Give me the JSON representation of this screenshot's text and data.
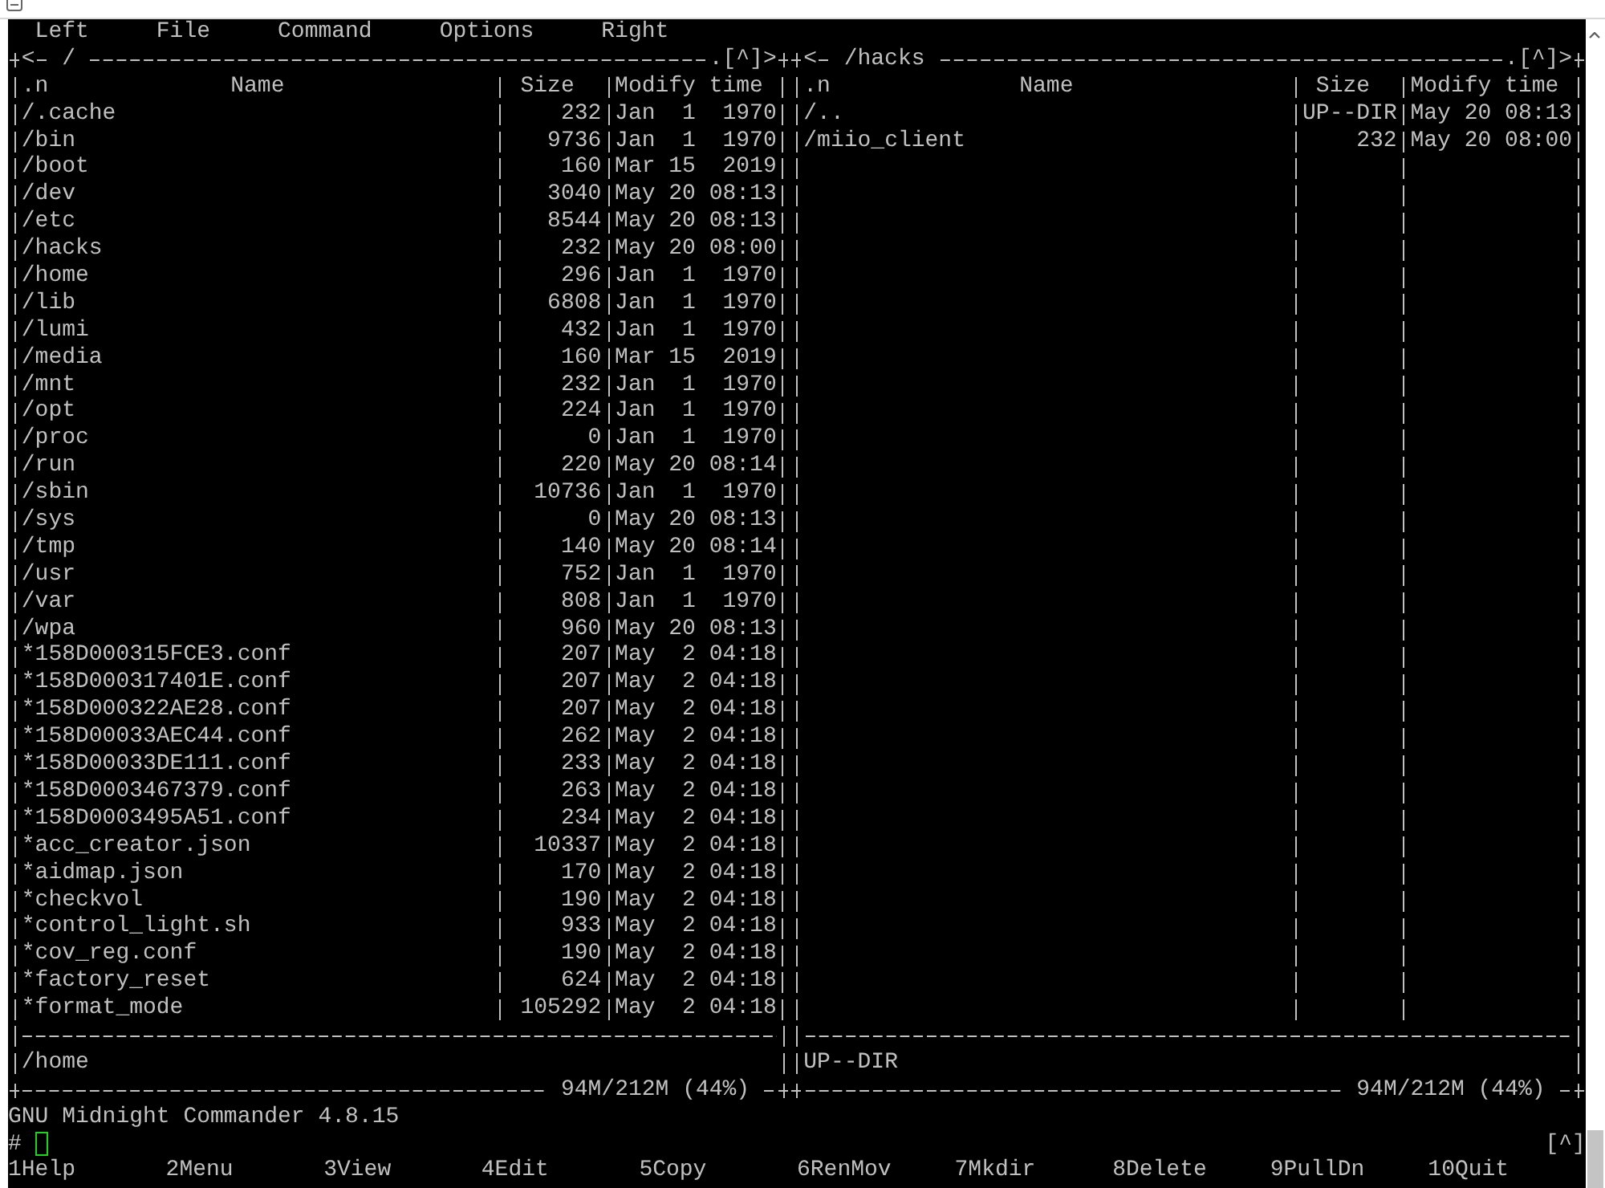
{
  "menu_bar": [
    "Left",
    "File",
    "Command",
    "Options",
    "Right"
  ],
  "panels": [
    {
      "back_button": "<",
      "path": "/",
      "hidden_toggle": ".",
      "history_button": "[^]",
      "forward_button": ">",
      "columns": {
        "sort": ".n",
        "name": "Name",
        "size": "Size",
        "modify_time": "Modify time"
      },
      "rows": [
        {
          "name": "/.cache",
          "size": "232",
          "modify_time": "Jan  1  1970"
        },
        {
          "name": "/bin",
          "size": "9736",
          "modify_time": "Jan  1  1970"
        },
        {
          "name": "/boot",
          "size": "160",
          "modify_time": "Mar 15  2019"
        },
        {
          "name": "/dev",
          "size": "3040",
          "modify_time": "May 20 08:13"
        },
        {
          "name": "/etc",
          "size": "8544",
          "modify_time": "May 20 08:13"
        },
        {
          "name": "/hacks",
          "size": "232",
          "modify_time": "May 20 08:00"
        },
        {
          "name": "/home",
          "size": "296",
          "modify_time": "Jan  1  1970"
        },
        {
          "name": "/lib",
          "size": "6808",
          "modify_time": "Jan  1  1970"
        },
        {
          "name": "/lumi",
          "size": "432",
          "modify_time": "Jan  1  1970"
        },
        {
          "name": "/media",
          "size": "160",
          "modify_time": "Mar 15  2019"
        },
        {
          "name": "/mnt",
          "size": "232",
          "modify_time": "Jan  1  1970"
        },
        {
          "name": "/opt",
          "size": "224",
          "modify_time": "Jan  1  1970"
        },
        {
          "name": "/proc",
          "size": "0",
          "modify_time": "Jan  1  1970"
        },
        {
          "name": "/run",
          "size": "220",
          "modify_time": "May 20 08:14"
        },
        {
          "name": "/sbin",
          "size": "10736",
          "modify_time": "Jan  1  1970"
        },
        {
          "name": "/sys",
          "size": "0",
          "modify_time": "May 20 08:13"
        },
        {
          "name": "/tmp",
          "size": "140",
          "modify_time": "May 20 08:14"
        },
        {
          "name": "/usr",
          "size": "752",
          "modify_time": "Jan  1  1970"
        },
        {
          "name": "/var",
          "size": "808",
          "modify_time": "Jan  1  1970"
        },
        {
          "name": "/wpa",
          "size": "960",
          "modify_time": "May 20 08:13"
        },
        {
          "name": "*158D000315FCE3.conf",
          "size": "207",
          "modify_time": "May  2 04:18"
        },
        {
          "name": "*158D000317401E.conf",
          "size": "207",
          "modify_time": "May  2 04:18"
        },
        {
          "name": "*158D000322AE28.conf",
          "size": "207",
          "modify_time": "May  2 04:18"
        },
        {
          "name": "*158D00033AEC44.conf",
          "size": "262",
          "modify_time": "May  2 04:18"
        },
        {
          "name": "*158D00033DE111.conf",
          "size": "233",
          "modify_time": "May  2 04:18"
        },
        {
          "name": "*158D0003467379.conf",
          "size": "263",
          "modify_time": "May  2 04:18"
        },
        {
          "name": "*158D0003495A51.conf",
          "size": "234",
          "modify_time": "May  2 04:18"
        },
        {
          "name": "*acc_creator.json",
          "size": "10337",
          "modify_time": "May  2 04:18"
        },
        {
          "name": "*aidmap.json",
          "size": "170",
          "modify_time": "May  2 04:18"
        },
        {
          "name": "*checkvol",
          "size": "190",
          "modify_time": "May  2 04:18"
        },
        {
          "name": "*control_light.sh",
          "size": "933",
          "modify_time": "May  2 04:18"
        },
        {
          "name": "*cov_reg.conf",
          "size": "190",
          "modify_time": "May  2 04:18"
        },
        {
          "name": "*factory_reset",
          "size": "624",
          "modify_time": "May  2 04:18"
        },
        {
          "name": "*format_mode",
          "size": "105292",
          "modify_time": "May  2 04:18"
        }
      ],
      "mini_status": "/home",
      "disk_usage": "94M/212M (44%)"
    },
    {
      "back_button": "<",
      "path": "/hacks",
      "hidden_toggle": ".",
      "history_button": "[^]",
      "forward_button": ">",
      "columns": {
        "sort": ".n",
        "name": "Name",
        "size": "Size",
        "modify_time": "Modify time"
      },
      "rows": [
        {
          "name": "/..",
          "size": "UP--DIR",
          "modify_time": "May 20 08:13"
        },
        {
          "name": "/miio_client",
          "size": "232",
          "modify_time": "May 20 08:00"
        }
      ],
      "mini_status": "UP--DIR",
      "disk_usage": "94M/212M (44%)"
    }
  ],
  "version_line": "GNU Midnight Commander 4.8.15",
  "command_line": {
    "prompt": "#",
    "history_button": "[^]"
  },
  "function_keys": [
    "1Help",
    "2Menu",
    "3View",
    "4Edit",
    "5Copy",
    "6RenMov",
    "7Mkdir",
    "8Delete",
    "9PullDn",
    "10Quit"
  ]
}
